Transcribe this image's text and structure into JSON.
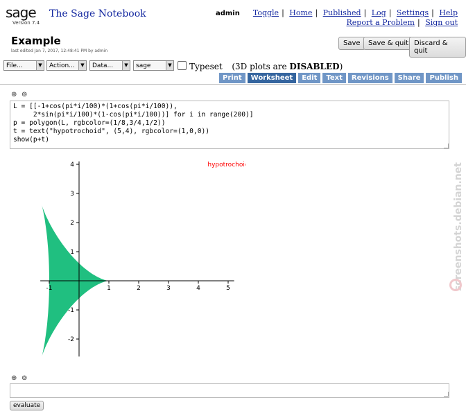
{
  "header": {
    "logo_text": "sage",
    "app_title": "The Sage Notebook",
    "version": "Version 7.4",
    "user": "admin",
    "nav": [
      "Toggle",
      "Home",
      "Published",
      "Log",
      "Settings",
      "Help"
    ],
    "nav2": [
      "Report a Problem",
      "Sign out"
    ]
  },
  "worksheet": {
    "title": "Example",
    "last_edited": "last edited Jan 7, 2017, 12:48:41 PM by admin",
    "buttons": [
      "Save",
      "Save & quit",
      "Discard & quit"
    ]
  },
  "toolbar": {
    "file": "File...",
    "action": "Action...",
    "data": "Data...",
    "system": "sage",
    "typeset_label": "Typeset",
    "plots_note_prefix": "(3D plots are ",
    "plots_note_bold": "DISABLED",
    "plots_note_suffix": ")"
  },
  "tabs": [
    {
      "label": "Print",
      "active": false
    },
    {
      "label": "Worksheet",
      "active": true
    },
    {
      "label": "Edit",
      "active": false
    },
    {
      "label": "Text",
      "active": false
    },
    {
      "label": "Revisions",
      "active": false
    },
    {
      "label": "Share",
      "active": false
    },
    {
      "label": "Publish",
      "active": false
    }
  ],
  "cell1": {
    "code": "L = [[-1+cos(pi*i/100)*(1+cos(pi*i/100)),\n     2*sin(pi*i/100)*(1-cos(pi*i/100))] for i in range(200)]\np = polygon(L, rgbcolor=(1/8,3/4,1/2))\nt = text(\"hypotrochoid\", (5,4), rgbcolor=(1,0,0))\nshow(p+t)"
  },
  "chart_data": {
    "type": "area",
    "series": [],
    "annotation": {
      "text": "hypotrochoid",
      "x": 5,
      "y": 4,
      "color": "#ff0000"
    },
    "fill_color": "#20bf80",
    "xlim": [
      -1.3,
      5.2
    ],
    "ylim": [
      -2.6,
      4.1
    ],
    "xticks": [
      "-1",
      "1",
      "2",
      "3",
      "4",
      "5"
    ],
    "yticks": [
      "-2",
      "-1",
      "1",
      "2",
      "3",
      "4"
    ],
    "grid": false
  },
  "cell2": {
    "code": "",
    "evaluate_label": "evaluate"
  },
  "watermark": "screenshots.debian.net"
}
